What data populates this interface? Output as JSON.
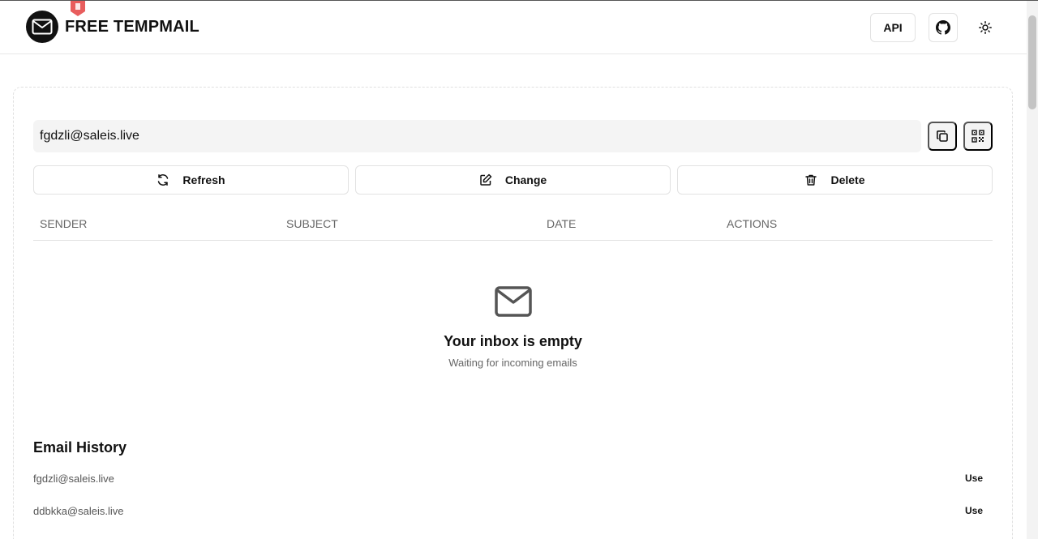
{
  "header": {
    "brand_title": "FREE TEMPMAIL",
    "api_label": "API"
  },
  "mailbox": {
    "address": "fgdzli@saleis.live"
  },
  "actions": {
    "refresh_label": "Refresh",
    "change_label": "Change",
    "delete_label": "Delete"
  },
  "table": {
    "columns": [
      "SENDER",
      "SUBJECT",
      "DATE",
      "ACTIONS"
    ]
  },
  "empty_state": {
    "title": "Your inbox is empty",
    "subtitle": "Waiting for incoming emails"
  },
  "history": {
    "title": "Email History",
    "items": [
      {
        "email": "fgdzli@saleis.live",
        "action": "Use"
      },
      {
        "email": "ddbkka@saleis.live",
        "action": "Use"
      }
    ]
  },
  "colors": {
    "accent": "#111111",
    "muted_text": "#666666",
    "input_bg": "#f4f4f4",
    "border": "#e2e2e2",
    "extension_badge": "#e85d5d"
  },
  "icons": {
    "logo": "mail-icon",
    "github": "github-icon",
    "theme": "sun-icon",
    "copy": "copy-icon",
    "qr": "qr-code-icon",
    "refresh": "refresh-icon",
    "change": "edit-icon",
    "delete": "trash-icon",
    "empty": "mail-icon"
  }
}
